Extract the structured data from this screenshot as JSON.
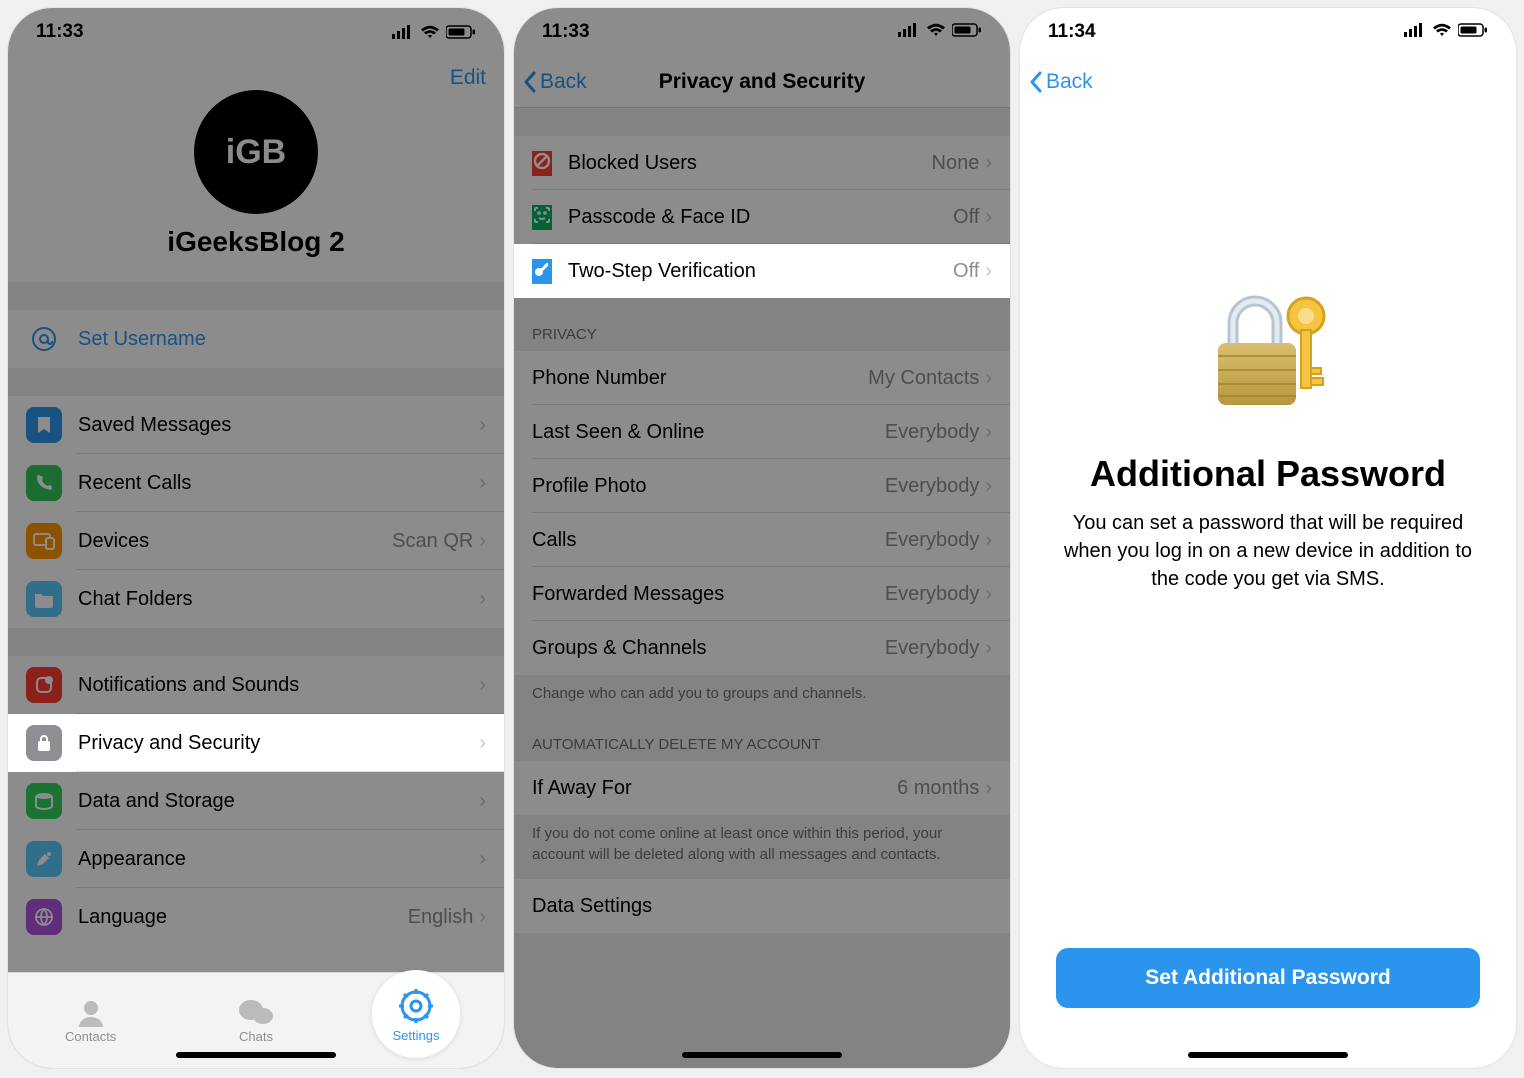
{
  "status": {
    "time1": "11:33",
    "time2": "11:33",
    "time3": "11:34"
  },
  "screen1": {
    "edit": "Edit",
    "avatarText": "iGB",
    "profileName": "iGeeksBlog 2",
    "setUsername": "Set Username",
    "rows": {
      "savedMessages": "Saved Messages",
      "recentCalls": "Recent Calls",
      "devices": "Devices",
      "devicesValue": "Scan QR",
      "chatFolders": "Chat Folders",
      "notifications": "Notifications and Sounds",
      "privacy": "Privacy and Security",
      "data": "Data and Storage",
      "appearance": "Appearance",
      "language": "Language",
      "languageValue": "English"
    },
    "tabs": {
      "contacts": "Contacts",
      "chats": "Chats",
      "settings": "Settings"
    }
  },
  "screen2": {
    "back": "Back",
    "title": "Privacy and Security",
    "blockedUsers": "Blocked Users",
    "blockedUsersValue": "None",
    "passcode": "Passcode & Face ID",
    "passcodeValue": "Off",
    "twoStep": "Two-Step Verification",
    "twoStepValue": "Off",
    "privacyHeader": "PRIVACY",
    "phoneNumber": "Phone Number",
    "phoneNumberValue": "My Contacts",
    "lastSeen": "Last Seen & Online",
    "everybody": "Everybody",
    "profilePhoto": "Profile Photo",
    "calls": "Calls",
    "forwarded": "Forwarded Messages",
    "groups": "Groups & Channels",
    "privacyFooter": "Change who can add you to groups and channels.",
    "deleteHeader": "AUTOMATICALLY DELETE MY ACCOUNT",
    "ifAway": "If Away For",
    "ifAwayValue": "6 months",
    "deleteFooter": "If you do not come online at least once within this period, your account will be deleted along with all messages and contacts.",
    "dataSettings": "Data Settings"
  },
  "screen3": {
    "back": "Back",
    "title": "Additional Password",
    "desc": "You can set a password that will be required when you log in on a new device in addition to the code you get via SMS.",
    "button": "Set Additional Password"
  }
}
